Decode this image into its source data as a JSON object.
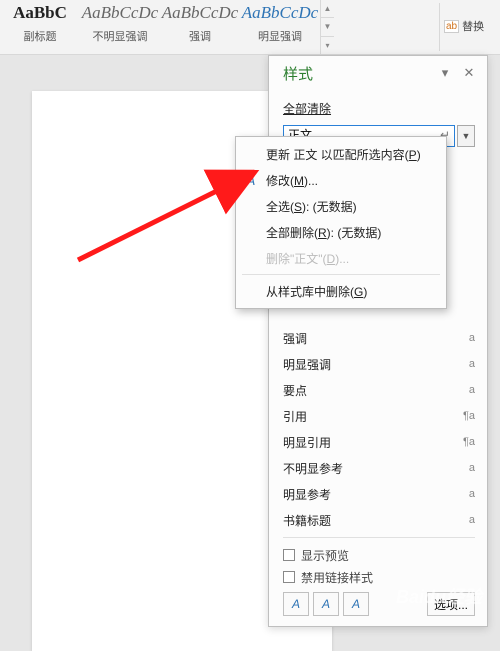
{
  "ribbon": {
    "styles": [
      {
        "preview": "AaBbC",
        "label": "副标题",
        "cls": "bold"
      },
      {
        "preview": "AaBbCcDc",
        "label": "不明显强调",
        "cls": "italic"
      },
      {
        "preview": "AaBbCcDc",
        "label": "强调",
        "cls": "italic"
      },
      {
        "preview": "AaBbCcDc",
        "label": "明显强调",
        "cls": "blue"
      }
    ],
    "edit": {
      "replace": "替换"
    }
  },
  "pane": {
    "title": "样式",
    "clear_all": "全部清除",
    "selected": "正文",
    "list": [
      {
        "name": "强调",
        "mark": "a"
      },
      {
        "name": "明显强调",
        "mark": "a"
      },
      {
        "name": "要点",
        "mark": "a"
      },
      {
        "name": "引用",
        "mark": "¶a"
      },
      {
        "name": "明显引用",
        "mark": "¶a"
      },
      {
        "name": "不明显参考",
        "mark": "a"
      },
      {
        "name": "明显参考",
        "mark": "a"
      },
      {
        "name": "书籍标题",
        "mark": "a"
      }
    ],
    "show_preview": "显示预览",
    "disable_linked": "禁用链接样式",
    "options": "选项..."
  },
  "ctx": {
    "update_match": "更新 正文 以匹配所选内容(P)",
    "modify": "修改(M)...",
    "select_all": "全选(S): (无数据)",
    "delete_all": "全部删除(R): (无数据)",
    "delete_style": "删除\"正文\"(D)...",
    "remove_gallery": "从样式库中删除(G)"
  },
  "watermark": "Baidu经验"
}
